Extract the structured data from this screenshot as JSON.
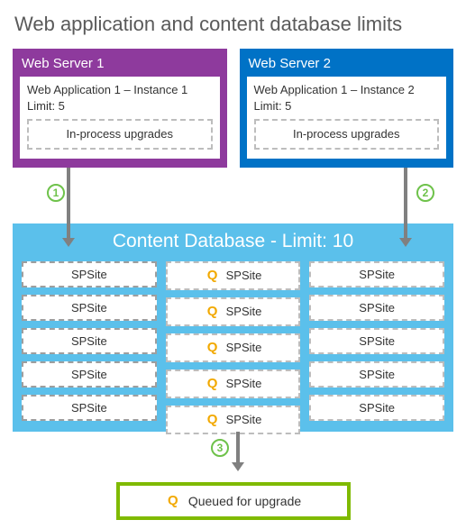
{
  "title": "Web application and content database limits",
  "servers": [
    {
      "name": "Web Server 1",
      "app_line": "Web Application 1 – Instance 1",
      "limit_line": "Limit: 5",
      "inproc": "In-process upgrades"
    },
    {
      "name": "Web Server 2",
      "app_line": "Web Application 1 – Instance 2",
      "limit_line": "Limit: 5",
      "inproc": "In-process upgrades"
    }
  ],
  "markers": {
    "one": "1",
    "two": "2",
    "three": "3"
  },
  "content_db": {
    "title": "Content Database - Limit: 10",
    "site_label": "SPSite",
    "columns": {
      "left": [
        "SPSite",
        "SPSite",
        "SPSite",
        "SPSite",
        "SPSite"
      ],
      "mid": [
        "SPSite",
        "SPSite",
        "SPSite",
        "SPSite",
        "SPSite"
      ],
      "right": [
        "SPSite",
        "SPSite",
        "SPSite",
        "SPSite",
        "SPSite"
      ]
    }
  },
  "q_glyph": "Q",
  "legend": "Queued for upgrade",
  "colors": {
    "purple": "#8e3a9d",
    "blue": "#0072c6",
    "sky": "#5bc0eb",
    "green_ring": "#6ec24a",
    "green_box": "#7fba00",
    "q": "#f2a900"
  }
}
